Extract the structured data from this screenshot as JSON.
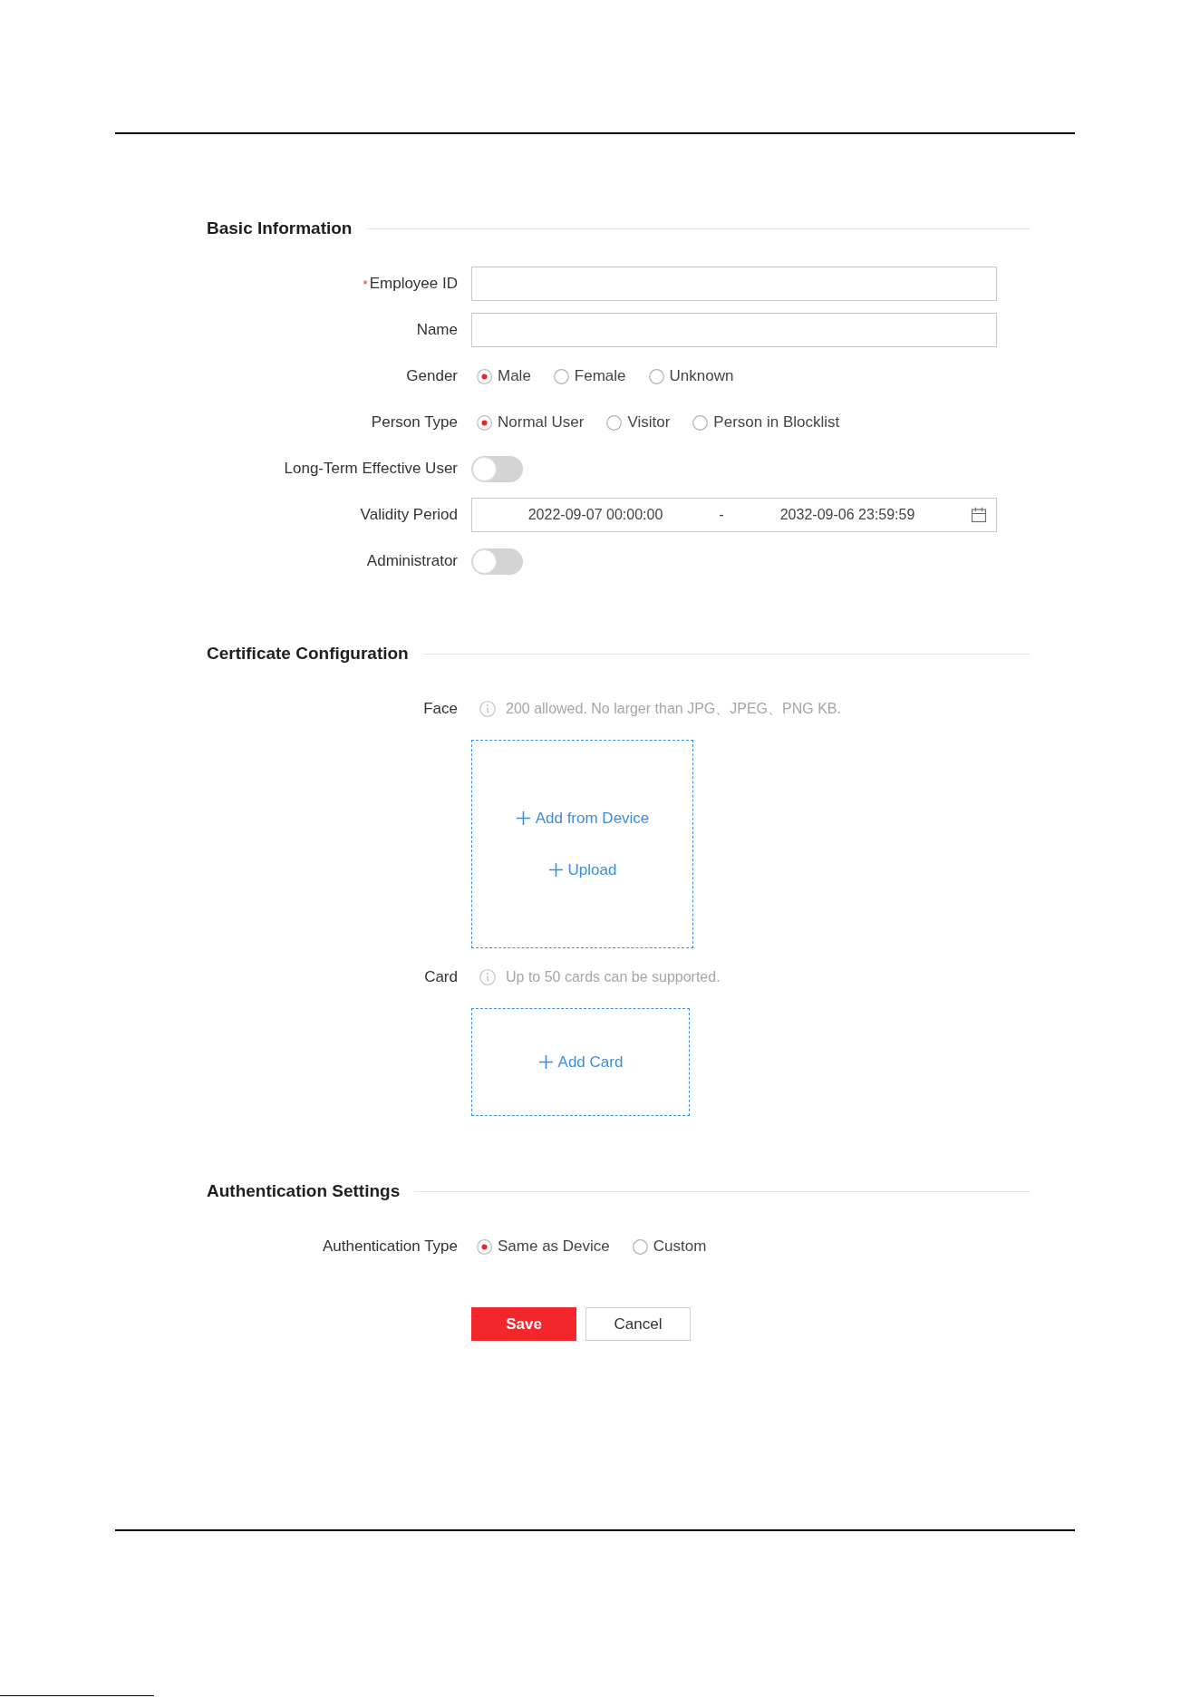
{
  "sections": [
    {
      "title": "Basic Information",
      "fields": [
        {
          "kind": "input",
          "label": "Employee ID",
          "required_mark": "*"
        },
        {
          "kind": "input",
          "label": "Name"
        },
        {
          "kind": "radio",
          "label": "Gender",
          "options": [
            {
              "label": "Male",
              "selected": true
            },
            {
              "label": "Female",
              "selected": false
            },
            {
              "label": "Unknown",
              "selected": false
            }
          ]
        },
        {
          "kind": "radio",
          "label": "Person Type",
          "options": [
            {
              "label": "Normal User",
              "selected": true
            },
            {
              "label": "Visitor",
              "selected": false
            },
            {
              "label": "Person in Blocklist",
              "selected": false
            }
          ]
        },
        {
          "kind": "toggle",
          "label": "Long-Term Effective User",
          "on": false
        },
        {
          "kind": "daterange",
          "label": "Validity Period",
          "start": "2022-09-07 00:00:00",
          "separator": "-",
          "end": "2032-09-06 23:59:59"
        },
        {
          "kind": "toggle",
          "label": "Administrator",
          "on": false
        }
      ]
    },
    {
      "title": "Certificate Configuration",
      "fields": [
        {
          "kind": "photo_upload",
          "label": "Face",
          "hint": "200 allowed. No larger than JPG、JPEG、PNG KB.",
          "actions": [
            "Add from Device",
            "Upload"
          ]
        },
        {
          "kind": "card_upload",
          "label": "Card",
          "hint": "Up to 50 cards can be supported.",
          "actions": [
            "Add Card"
          ]
        }
      ]
    },
    {
      "title": "Authentication Settings",
      "fields": [
        {
          "kind": "radio",
          "label": "Authentication Type",
          "options": [
            {
              "label": "Same as Device",
              "selected": true
            },
            {
              "label": "Custom",
              "selected": false
            }
          ]
        }
      ]
    }
  ],
  "buttons": [
    {
      "kind": "primary",
      "label": "Save"
    },
    {
      "kind": "secondary",
      "label": "Cancel"
    }
  ]
}
